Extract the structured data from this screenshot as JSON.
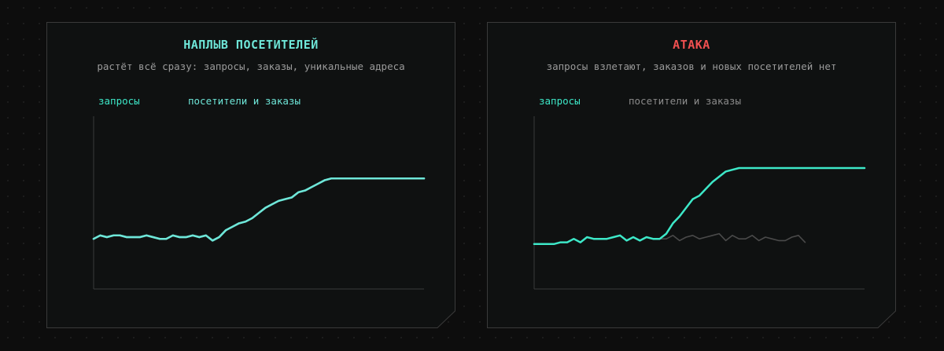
{
  "colors": {
    "accent": "#3de8c8",
    "title_left": "#6ee6d8",
    "title_right": "#f05050",
    "muted_series": "#4a4a4a",
    "muted_legend": "#8a8a8a",
    "panel_bg": "#0f1111",
    "panel_border": "#3a3a3a",
    "axis": "#3a3a3a"
  },
  "panels": [
    {
      "title": "НАПЛЫВ ПОСЕТИТЕЛЕЙ",
      "subtitle": "растёт всё сразу: запросы, заказы, уникальные адреса",
      "legend": [
        "запросы",
        "посетители и заказы"
      ]
    },
    {
      "title": "АТАКА",
      "subtitle": "запросы взлетают, заказов и новых посетителей нет",
      "legend": [
        "запросы",
        "посетители и заказы"
      ]
    }
  ],
  "chart_data": [
    {
      "type": "line",
      "ylim": [
        0,
        100
      ],
      "series": [
        {
          "name": "запросы",
          "values": [
            29,
            31,
            30,
            31,
            31,
            30,
            30,
            30,
            31,
            30,
            29,
            29,
            31,
            30,
            30,
            31,
            30,
            31,
            28,
            30,
            34,
            36,
            38,
            39,
            41,
            44,
            47,
            49,
            51,
            52,
            53,
            56,
            57,
            59,
            61,
            63,
            64,
            64,
            64,
            64,
            64,
            64,
            64,
            64,
            64,
            64,
            64,
            64,
            64,
            64,
            64
          ]
        },
        {
          "name": "посетители и заказы",
          "values": [
            29,
            31,
            30,
            31,
            31,
            30,
            30,
            30,
            31,
            30,
            29,
            29,
            31,
            30,
            30,
            31,
            30,
            31,
            28,
            30,
            34,
            36,
            38,
            39,
            41,
            44,
            47,
            49,
            51,
            52,
            53,
            56,
            57,
            59,
            61,
            63,
            64,
            64,
            64,
            64,
            64,
            64,
            64,
            64,
            64,
            64,
            64,
            64,
            64,
            64,
            64
          ]
        }
      ]
    },
    {
      "type": "line",
      "ylim": [
        0,
        100
      ],
      "series": [
        {
          "name": "запросы",
          "values": [
            26,
            26,
            26,
            26,
            27,
            27,
            29,
            27,
            30,
            29,
            29,
            29,
            30,
            31,
            28,
            30,
            28,
            30,
            29,
            29,
            32,
            38,
            42,
            47,
            52,
            54,
            58,
            62,
            65,
            68,
            69,
            70,
            70,
            70,
            70,
            70,
            70,
            70,
            70,
            70,
            70,
            70,
            70,
            70,
            70,
            70,
            70,
            70,
            70,
            70,
            70
          ]
        },
        {
          "name": "посетители и заказы",
          "values": [
            26,
            26,
            26,
            26,
            27,
            27,
            29,
            27,
            30,
            29,
            29,
            29,
            30,
            31,
            28,
            30,
            28,
            30,
            29,
            29,
            29,
            31,
            28,
            30,
            31,
            29,
            30,
            31,
            32,
            28,
            31,
            29,
            29,
            31,
            28,
            30,
            29,
            28,
            28,
            30,
            31,
            27
          ]
        }
      ]
    }
  ]
}
